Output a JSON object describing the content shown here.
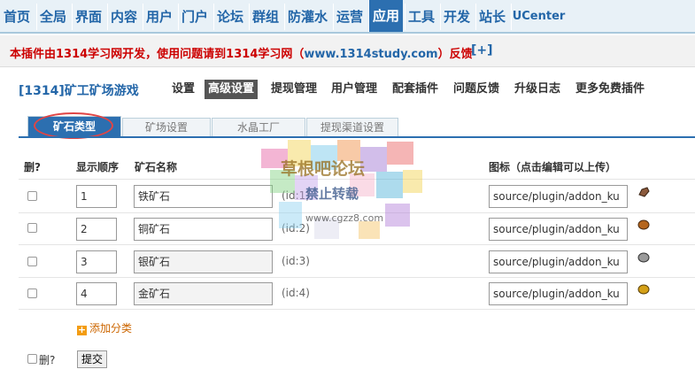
{
  "topnav": {
    "items": [
      "首页",
      "全局",
      "界面",
      "内容",
      "用户",
      "门户",
      "论坛",
      "群组",
      "防灌水",
      "运营",
      "应用",
      "工具",
      "开发",
      "站长",
      "UCenter"
    ],
    "active": "应用"
  },
  "notice": {
    "prefix": "本插件由1314学习网开发，使用问题请到1314学习网（",
    "url": "www.1314study.com",
    "suffix": "）反馈",
    "plus": "[+]"
  },
  "plugin": {
    "title": "[1314]矿工矿场游戏",
    "menu": [
      "设置",
      "高级设置",
      "提现管理",
      "用户管理",
      "配套插件",
      "问题反馈",
      "升级日志",
      "更多免费插件"
    ],
    "active_menu": "高级设置"
  },
  "tabs": [
    "矿石类型",
    "矿场设置",
    "水晶工厂",
    "提现渠道设置"
  ],
  "table": {
    "headers": {
      "delete": "删?",
      "order": "显示顺序",
      "name": "矿石名称",
      "icon": "图标（点击编辑可以上传）"
    },
    "rows": [
      {
        "order": "1",
        "name": "铁矿石",
        "id": "(id:1)",
        "icon_path": "source/plugin/addon_ku",
        "icon_color": "#8b5a3c"
      },
      {
        "order": "2",
        "name": "铜矿石",
        "id": "(id:2)",
        "icon_path": "source/plugin/addon_ku",
        "icon_color": "#b5651d"
      },
      {
        "order": "3",
        "name": "银矿石",
        "id": "(id:3)",
        "icon_path": "source/plugin/addon_ku",
        "icon_color": "#7a7a7a"
      },
      {
        "order": "4",
        "name": "金矿石",
        "id": "(id:4)",
        "icon_path": "source/plugin/addon_ku",
        "icon_color": "#d4a017"
      }
    ]
  },
  "add_category": "添加分类",
  "footer": {
    "delete_label": "删?",
    "submit": "提交"
  },
  "watermark": {
    "line1": "草根吧论坛",
    "line2": "禁止转载",
    "line3": "www.cgzz8.com"
  },
  "colors": {
    "accent": "#2c6fb0",
    "nav_text": "#2366a8",
    "notice_red": "#cc0000"
  }
}
